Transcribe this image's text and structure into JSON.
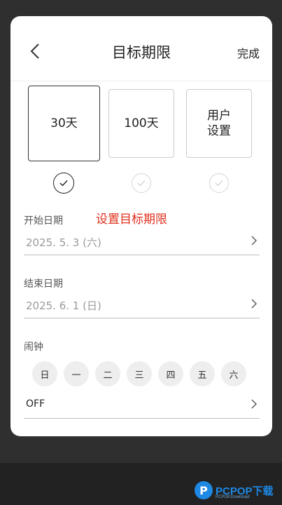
{
  "header": {
    "title": "目标期限",
    "done_label": "完成"
  },
  "options": [
    {
      "label": "30天",
      "selected": true
    },
    {
      "label": "100天",
      "selected": false
    },
    {
      "label": "用户\n设置",
      "selected": false
    }
  ],
  "annotation": "设置目标期限",
  "start": {
    "label": "开始日期",
    "value": "2025. 5. 3 (六)"
  },
  "end": {
    "label": "结束日期",
    "value": "2025. 6. 1 (日)"
  },
  "alarm": {
    "label": "闹钟",
    "days": [
      "日",
      "一",
      "二",
      "三",
      "四",
      "五",
      "六"
    ],
    "value": "OFF"
  },
  "watermark": {
    "logo": "P",
    "text": "PCPOP下载",
    "sub": "PCPOP.Download"
  },
  "colors": {
    "annotation": "#e0301e",
    "sheet": "#ffffff",
    "background": "#2f2f2f",
    "watermark": "#1e88e5"
  }
}
